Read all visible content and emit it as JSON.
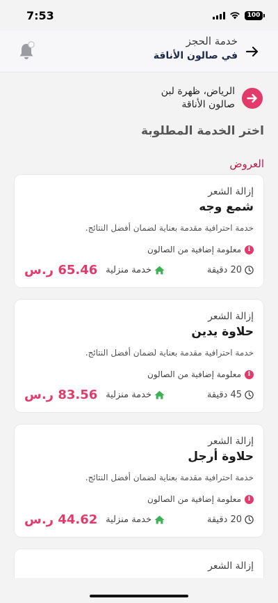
{
  "status_bar": {
    "time": "7:53",
    "battery": "100"
  },
  "header": {
    "subtitle": "خدمة الحجز",
    "title": "في صالون الأناقة"
  },
  "location": {
    "line1": "الرياض، ظهرة لبن",
    "line2": "صالون الأناقة"
  },
  "page_title": "اختر الخدمة المطلوبة",
  "section_label": "العروض",
  "services": [
    {
      "category": "إزالة الشعر",
      "name": "شمع وجه",
      "description": "خدمة احترافية مقدمة بعناية لضمان أفضل النتائج.",
      "info": "معلومة إضافية من الصالون",
      "duration": "20 دقيقة",
      "location_type": "خدمة منزلية",
      "price": "65.46 ر.س"
    },
    {
      "category": "إزالة الشعر",
      "name": "حلاوة يدين",
      "description": "خدمة احترافية مقدمة بعناية لضمان أفضل النتائج.",
      "info": "معلومة إضافية من الصالون",
      "duration": "45 دقيقة",
      "location_type": "خدمة منزلية",
      "price": "83.56 ر.س"
    },
    {
      "category": "إزالة الشعر",
      "name": "حلاوة أرجل",
      "description": "خدمة احترافية مقدمة بعناية لضمان أفضل النتائج.",
      "info": "معلومة إضافية من الصالون",
      "duration": "20 دقيقة",
      "location_type": "خدمة منزلية",
      "price": "44.62 ر.س"
    },
    {
      "category": "إزالة الشعر"
    }
  ],
  "colors": {
    "accent": "#e23a6a",
    "section_label": "#b21f4b",
    "home_icon": "#3bb054"
  },
  "icons": {
    "back": "arrow-right-icon",
    "notifications": "bell-icon",
    "location": "arrow-right-circle-icon",
    "info": "info-icon",
    "duration": "clock-icon",
    "home_service": "home-icon"
  }
}
